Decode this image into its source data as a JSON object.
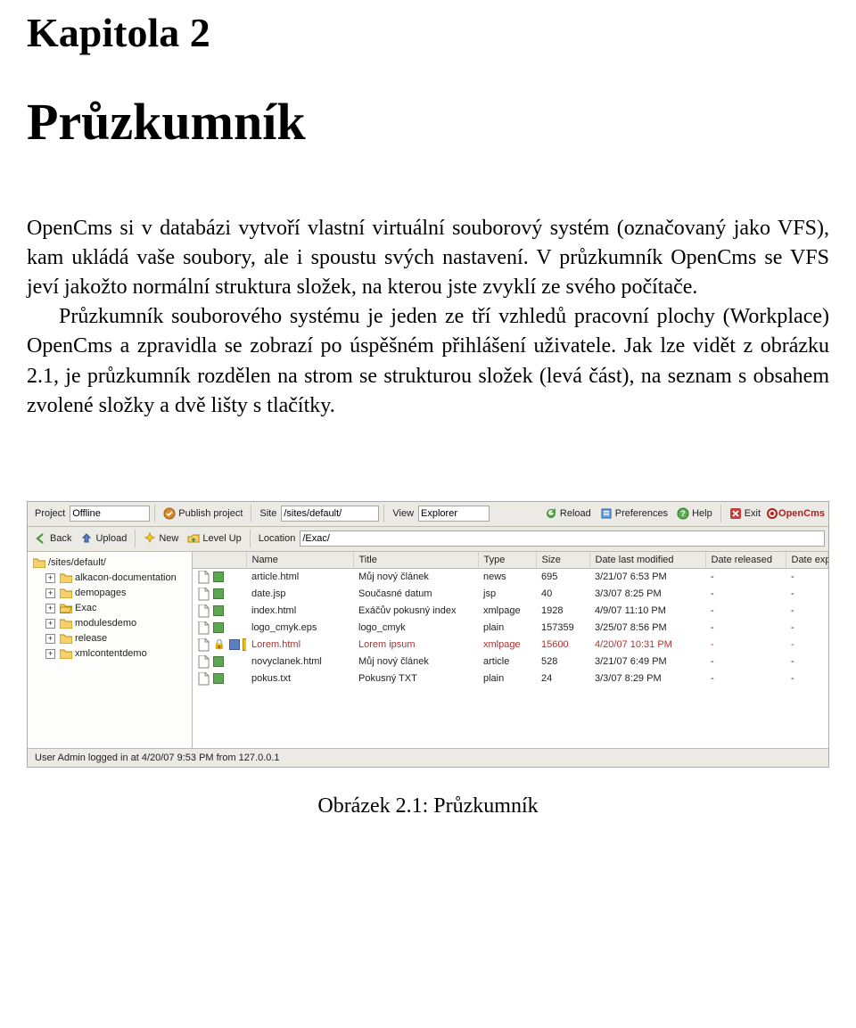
{
  "chapter": {
    "label": "Kapitola 2",
    "title": "Průzkumník"
  },
  "paragraphs": {
    "p1": "OpenCms si v databázi vytvoří vlastní virtuální souborový systém (označovaný jako VFS), kam ukládá vaše soubory, ale i spoustu svých nastavení. V průzkumník OpenCms se VFS jeví jakožto normální struktura složek, na kterou jste zvyklí ze svého počítače.",
    "p2": "Průzkumník souborového systému je jeden ze tří vzhledů pracovní plochy (Workplace) OpenCms a zpravidla se zobrazí po úspěšném přihlášení uživatele. Jak lze vidět z obrázku 2.1, je průzkumník rozdělen na strom se strukturou složek (levá část), na seznam s obsahem zvolené složky a dvě lišty s tlačítky."
  },
  "figure": {
    "caption": "Obrázek 2.1: Průzkumník",
    "toolbar1": {
      "project_label": "Project",
      "project_value": "Offline",
      "publish_label": "Publish project",
      "site_label": "Site",
      "site_value": "/sites/default/",
      "view_label": "View",
      "view_value": "Explorer",
      "reload_label": "Reload",
      "preferences_label": "Preferences",
      "help_label": "Help",
      "exit_label": "Exit",
      "logo_text": "OpenCms"
    },
    "toolbar2": {
      "back_label": "Back",
      "upload_label": "Upload",
      "new_label": "New",
      "levelup_label": "Level Up",
      "location_label": "Location",
      "location_value": "/Exac/"
    },
    "tree": {
      "root": "/sites/default/",
      "items": [
        "alkacon-documentation",
        "demopages",
        "Exac",
        "modulesdemo",
        "release",
        "xmlcontentdemo"
      ],
      "open_index": 2
    },
    "columns": {
      "status": "",
      "name": "Name",
      "title": "Title",
      "type": "Type",
      "size": "Size",
      "modified": "Date last modified",
      "released": "Date released",
      "expired": "Date expired"
    },
    "rows": [
      {
        "locked": false,
        "lock": "",
        "pub": "green",
        "flag": false,
        "name": "article.html",
        "title": "Můj nový článek",
        "type": "news",
        "size": "695",
        "modified": "3/21/07 6:53 PM",
        "released": "-",
        "expired": "-"
      },
      {
        "locked": false,
        "lock": "",
        "pub": "green",
        "flag": false,
        "name": "date.jsp",
        "title": "Současné datum",
        "type": "jsp",
        "size": "40",
        "modified": "3/3/07 8:25 PM",
        "released": "-",
        "expired": "-"
      },
      {
        "locked": false,
        "lock": "",
        "pub": "green",
        "flag": false,
        "name": "index.html",
        "title": "Exáčův pokusný index",
        "type": "xmlpage",
        "size": "1928",
        "modified": "4/9/07 11:10 PM",
        "released": "-",
        "expired": "-"
      },
      {
        "locked": false,
        "lock": "",
        "pub": "green",
        "flag": false,
        "name": "logo_cmyk.eps",
        "title": "logo_cmyk",
        "type": "plain",
        "size": "157359",
        "modified": "3/25/07 8:56 PM",
        "released": "-",
        "expired": "-"
      },
      {
        "locked": true,
        "lock": "🔒",
        "pub": "blue",
        "flag": true,
        "name": "Lorem.html",
        "title": "Lorem ipsum",
        "type": "xmlpage",
        "size": "15600",
        "modified": "4/20/07 10:31 PM",
        "released": "-",
        "expired": "-"
      },
      {
        "locked": false,
        "lock": "",
        "pub": "green",
        "flag": false,
        "name": "novyclanek.html",
        "title": "Můj nový článek",
        "type": "article",
        "size": "528",
        "modified": "3/21/07 6:49 PM",
        "released": "-",
        "expired": "-"
      },
      {
        "locked": false,
        "lock": "",
        "pub": "green",
        "flag": false,
        "name": "pokus.txt",
        "title": "Pokusný TXT",
        "type": "plain",
        "size": "24",
        "modified": "3/3/07 8:29 PM",
        "released": "-",
        "expired": "-"
      }
    ],
    "status_text": "User Admin logged in at 4/20/07 9:53 PM from 127.0.0.1"
  }
}
